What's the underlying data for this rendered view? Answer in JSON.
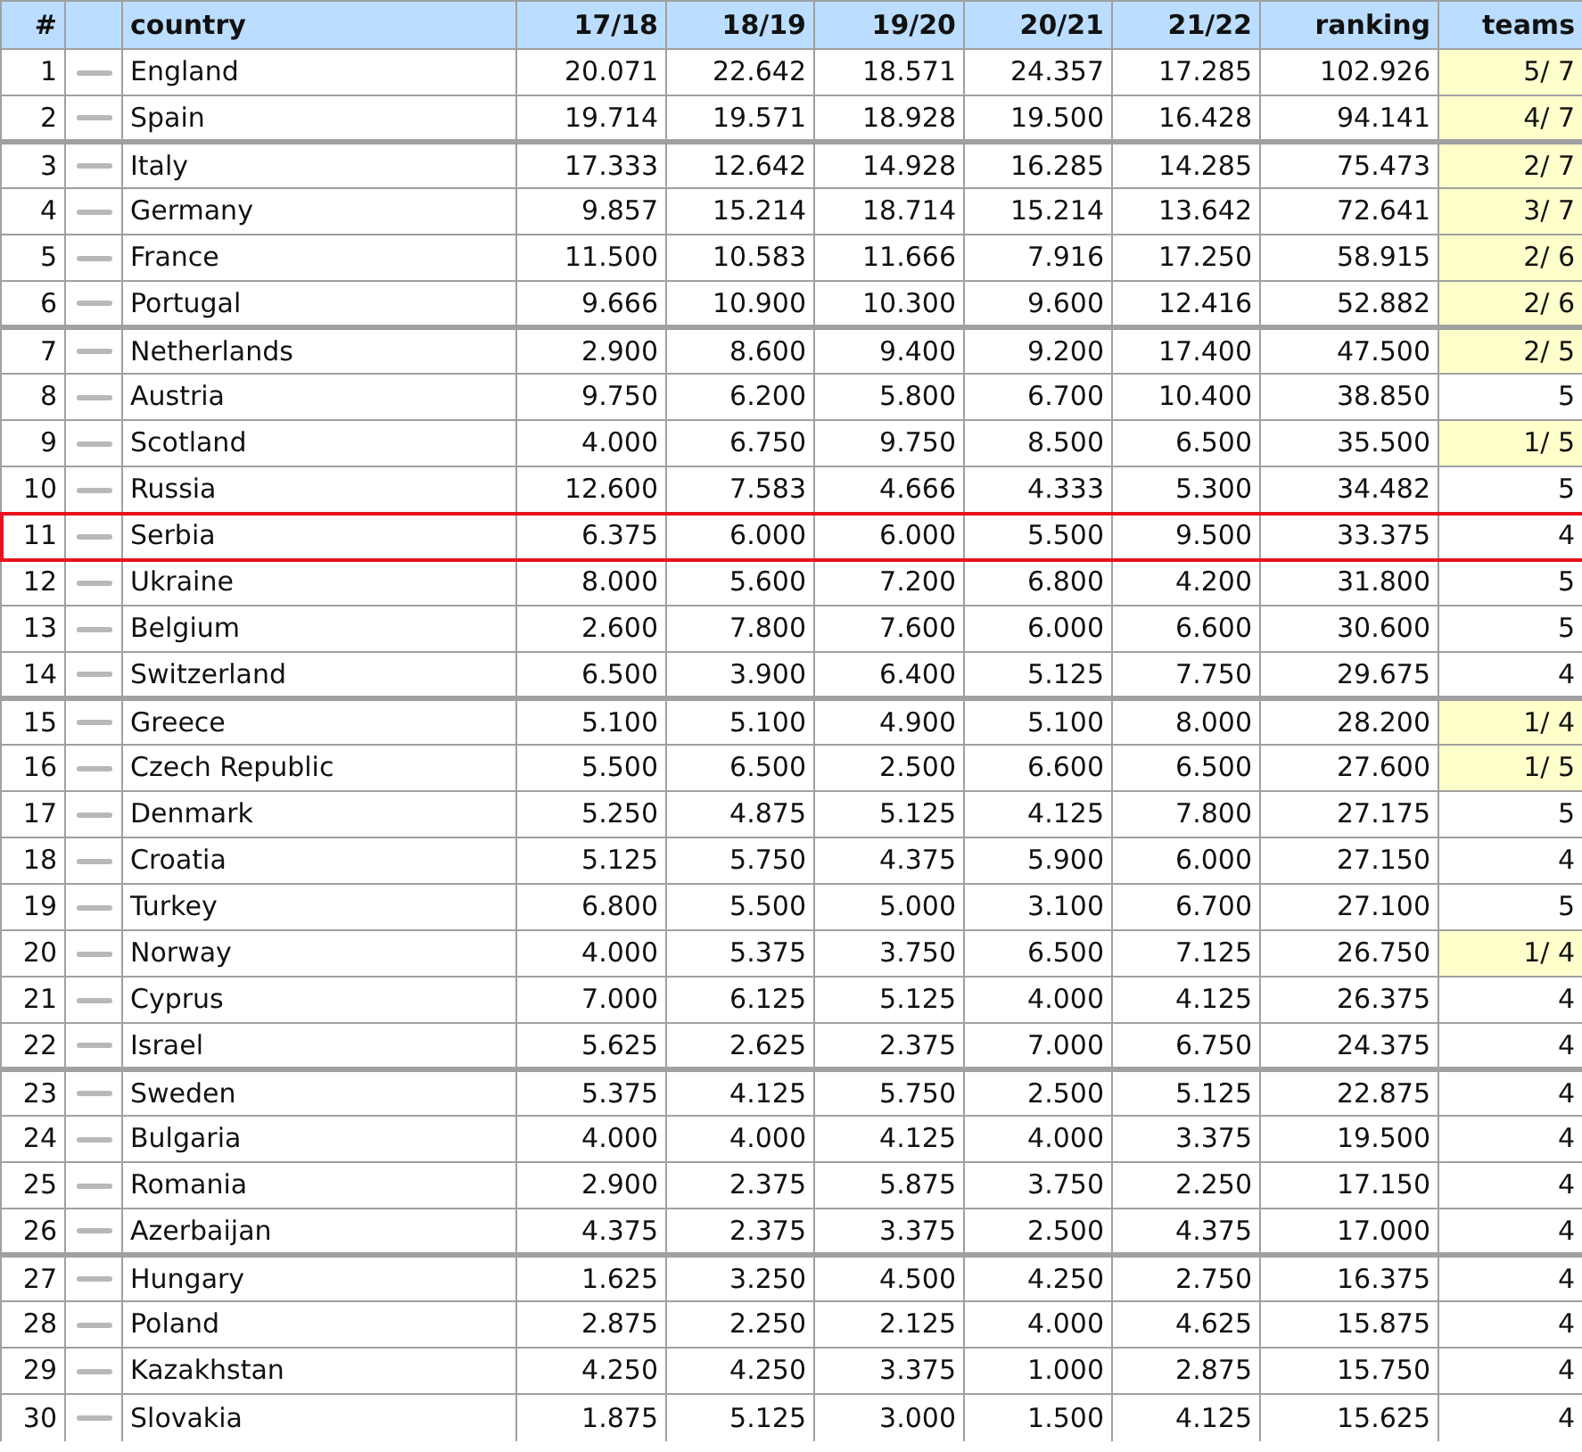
{
  "table": {
    "columns": [
      "#",
      "country",
      "17/18",
      "18/19",
      "19/20",
      "20/21",
      "21/22",
      "ranking",
      "teams"
    ],
    "rows": [
      {
        "rank": "1",
        "country": "England",
        "seasons": [
          "20.071",
          "22.642",
          "18.571",
          "24.357",
          "17.285"
        ],
        "ranking": "102.926",
        "teams": "5/ 7",
        "highlight": true,
        "group_end": false,
        "selected": false
      },
      {
        "rank": "2",
        "country": "Spain",
        "seasons": [
          "19.714",
          "19.571",
          "18.928",
          "19.500",
          "16.428"
        ],
        "ranking": "94.141",
        "teams": "4/ 7",
        "highlight": true,
        "group_end": true,
        "selected": false
      },
      {
        "rank": "3",
        "country": "Italy",
        "seasons": [
          "17.333",
          "12.642",
          "14.928",
          "16.285",
          "14.285"
        ],
        "ranking": "75.473",
        "teams": "2/ 7",
        "highlight": true,
        "group_end": false,
        "selected": false
      },
      {
        "rank": "4",
        "country": "Germany",
        "seasons": [
          "9.857",
          "15.214",
          "18.714",
          "15.214",
          "13.642"
        ],
        "ranking": "72.641",
        "teams": "3/ 7",
        "highlight": true,
        "group_end": false,
        "selected": false
      },
      {
        "rank": "5",
        "country": "France",
        "seasons": [
          "11.500",
          "10.583",
          "11.666",
          "7.916",
          "17.250"
        ],
        "ranking": "58.915",
        "teams": "2/ 6",
        "highlight": true,
        "group_end": false,
        "selected": false
      },
      {
        "rank": "6",
        "country": "Portugal",
        "seasons": [
          "9.666",
          "10.900",
          "10.300",
          "9.600",
          "12.416"
        ],
        "ranking": "52.882",
        "teams": "2/ 6",
        "highlight": true,
        "group_end": true,
        "selected": false
      },
      {
        "rank": "7",
        "country": "Netherlands",
        "seasons": [
          "2.900",
          "8.600",
          "9.400",
          "9.200",
          "17.400"
        ],
        "ranking": "47.500",
        "teams": "2/ 5",
        "highlight": true,
        "group_end": false,
        "selected": false
      },
      {
        "rank": "8",
        "country": "Austria",
        "seasons": [
          "9.750",
          "6.200",
          "5.800",
          "6.700",
          "10.400"
        ],
        "ranking": "38.850",
        "teams": "5",
        "highlight": false,
        "group_end": false,
        "selected": false
      },
      {
        "rank": "9",
        "country": "Scotland",
        "seasons": [
          "4.000",
          "6.750",
          "9.750",
          "8.500",
          "6.500"
        ],
        "ranking": "35.500",
        "teams": "1/ 5",
        "highlight": true,
        "group_end": false,
        "selected": false
      },
      {
        "rank": "10",
        "country": "Russia",
        "seasons": [
          "12.600",
          "7.583",
          "4.666",
          "4.333",
          "5.300"
        ],
        "ranking": "34.482",
        "teams": "5",
        "highlight": false,
        "group_end": false,
        "selected": false
      },
      {
        "rank": "11",
        "country": "Serbia",
        "seasons": [
          "6.375",
          "6.000",
          "6.000",
          "5.500",
          "9.500"
        ],
        "ranking": "33.375",
        "teams": "4",
        "highlight": false,
        "group_end": false,
        "selected": true
      },
      {
        "rank": "12",
        "country": "Ukraine",
        "seasons": [
          "8.000",
          "5.600",
          "7.200",
          "6.800",
          "4.200"
        ],
        "ranking": "31.800",
        "teams": "5",
        "highlight": false,
        "group_end": false,
        "selected": false
      },
      {
        "rank": "13",
        "country": "Belgium",
        "seasons": [
          "2.600",
          "7.800",
          "7.600",
          "6.000",
          "6.600"
        ],
        "ranking": "30.600",
        "teams": "5",
        "highlight": false,
        "group_end": false,
        "selected": false
      },
      {
        "rank": "14",
        "country": "Switzerland",
        "seasons": [
          "6.500",
          "3.900",
          "6.400",
          "5.125",
          "7.750"
        ],
        "ranking": "29.675",
        "teams": "4",
        "highlight": false,
        "group_end": true,
        "selected": false
      },
      {
        "rank": "15",
        "country": "Greece",
        "seasons": [
          "5.100",
          "5.100",
          "4.900",
          "5.100",
          "8.000"
        ],
        "ranking": "28.200",
        "teams": "1/ 4",
        "highlight": true,
        "group_end": false,
        "selected": false
      },
      {
        "rank": "16",
        "country": "Czech Republic",
        "seasons": [
          "5.500",
          "6.500",
          "2.500",
          "6.600",
          "6.500"
        ],
        "ranking": "27.600",
        "teams": "1/ 5",
        "highlight": true,
        "group_end": false,
        "selected": false
      },
      {
        "rank": "17",
        "country": "Denmark",
        "seasons": [
          "5.250",
          "4.875",
          "5.125",
          "4.125",
          "7.800"
        ],
        "ranking": "27.175",
        "teams": "5",
        "highlight": false,
        "group_end": false,
        "selected": false
      },
      {
        "rank": "18",
        "country": "Croatia",
        "seasons": [
          "5.125",
          "5.750",
          "4.375",
          "5.900",
          "6.000"
        ],
        "ranking": "27.150",
        "teams": "4",
        "highlight": false,
        "group_end": false,
        "selected": false
      },
      {
        "rank": "19",
        "country": "Turkey",
        "seasons": [
          "6.800",
          "5.500",
          "5.000",
          "3.100",
          "6.700"
        ],
        "ranking": "27.100",
        "teams": "5",
        "highlight": false,
        "group_end": false,
        "selected": false
      },
      {
        "rank": "20",
        "country": "Norway",
        "seasons": [
          "4.000",
          "5.375",
          "3.750",
          "6.500",
          "7.125"
        ],
        "ranking": "26.750",
        "teams": "1/ 4",
        "highlight": true,
        "group_end": false,
        "selected": false
      },
      {
        "rank": "21",
        "country": "Cyprus",
        "seasons": [
          "7.000",
          "6.125",
          "5.125",
          "4.000",
          "4.125"
        ],
        "ranking": "26.375",
        "teams": "4",
        "highlight": false,
        "group_end": false,
        "selected": false
      },
      {
        "rank": "22",
        "country": "Israel",
        "seasons": [
          "5.625",
          "2.625",
          "2.375",
          "7.000",
          "6.750"
        ],
        "ranking": "24.375",
        "teams": "4",
        "highlight": false,
        "group_end": true,
        "selected": false
      },
      {
        "rank": "23",
        "country": "Sweden",
        "seasons": [
          "5.375",
          "4.125",
          "5.750",
          "2.500",
          "5.125"
        ],
        "ranking": "22.875",
        "teams": "4",
        "highlight": false,
        "group_end": false,
        "selected": false
      },
      {
        "rank": "24",
        "country": "Bulgaria",
        "seasons": [
          "4.000",
          "4.000",
          "4.125",
          "4.000",
          "3.375"
        ],
        "ranking": "19.500",
        "teams": "4",
        "highlight": false,
        "group_end": false,
        "selected": false
      },
      {
        "rank": "25",
        "country": "Romania",
        "seasons": [
          "2.900",
          "2.375",
          "5.875",
          "3.750",
          "2.250"
        ],
        "ranking": "17.150",
        "teams": "4",
        "highlight": false,
        "group_end": false,
        "selected": false
      },
      {
        "rank": "26",
        "country": "Azerbaijan",
        "seasons": [
          "4.375",
          "2.375",
          "3.375",
          "2.500",
          "4.375"
        ],
        "ranking": "17.000",
        "teams": "4",
        "highlight": false,
        "group_end": true,
        "selected": false
      },
      {
        "rank": "27",
        "country": "Hungary",
        "seasons": [
          "1.625",
          "3.250",
          "4.500",
          "4.250",
          "2.750"
        ],
        "ranking": "16.375",
        "teams": "4",
        "highlight": false,
        "group_end": false,
        "selected": false
      },
      {
        "rank": "28",
        "country": "Poland",
        "seasons": [
          "2.875",
          "2.250",
          "2.125",
          "4.000",
          "4.625"
        ],
        "ranking": "15.875",
        "teams": "4",
        "highlight": false,
        "group_end": false,
        "selected": false
      },
      {
        "rank": "29",
        "country": "Kazakhstan",
        "seasons": [
          "4.250",
          "4.250",
          "3.375",
          "1.000",
          "2.875"
        ],
        "ranking": "15.750",
        "teams": "4",
        "highlight": false,
        "group_end": false,
        "selected": false
      },
      {
        "rank": "30",
        "country": "Slovakia",
        "seasons": [
          "1.875",
          "5.125",
          "3.000",
          "1.500",
          "4.125"
        ],
        "ranking": "15.625",
        "teams": "4",
        "highlight": false,
        "group_end": false,
        "selected": false
      }
    ]
  }
}
